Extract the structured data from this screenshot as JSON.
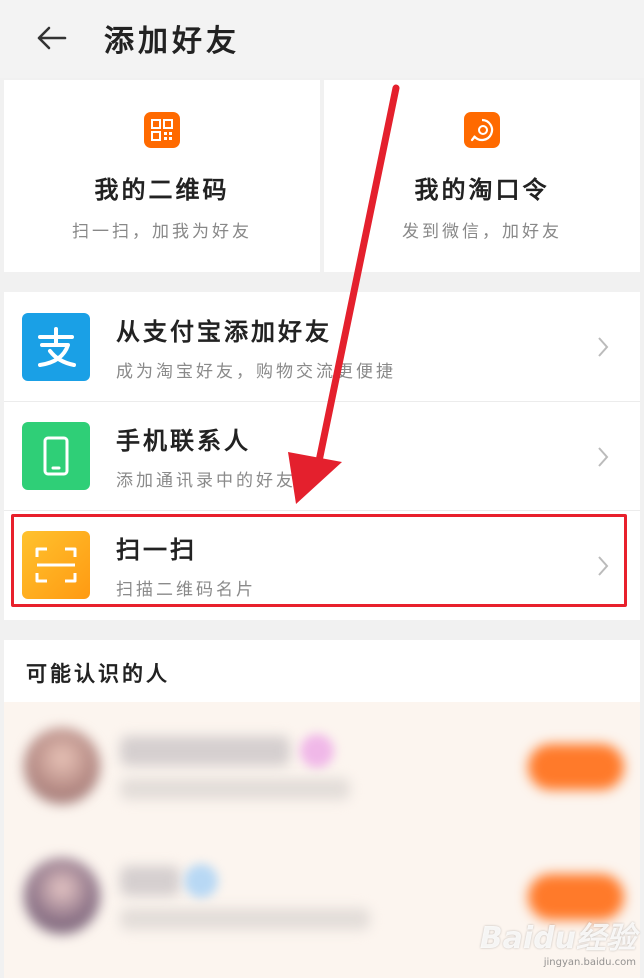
{
  "header": {
    "title": "添加好友"
  },
  "qr_cards": [
    {
      "title": "我的二维码",
      "subtitle": "扫一扫，加我为好友",
      "icon": "qr-code-icon"
    },
    {
      "title": "我的淘口令",
      "subtitle": "发到微信，加好友",
      "icon": "taobao-token-icon"
    }
  ],
  "add_options": [
    {
      "title": "从支付宝添加好友",
      "subtitle": "成为淘宝好友，购物交流更便捷",
      "icon": "alipay-icon",
      "color": "#1aa0e6"
    },
    {
      "title": "手机联系人",
      "subtitle": "添加通讯录中的好友",
      "icon": "phone-icon",
      "color": "#2fcf77"
    },
    {
      "title": "扫一扫",
      "subtitle": "扫描二维码名片",
      "icon": "scan-icon",
      "color": "#ffad1f"
    }
  ],
  "people_section": {
    "title": "可能认识的人"
  },
  "watermark": {
    "main": "Baidu经验",
    "sub": "jingyan.baidu.com"
  },
  "colors": {
    "accent": "#ff6a00",
    "highlight": "#e8202c",
    "arrow": "#e4202d"
  }
}
